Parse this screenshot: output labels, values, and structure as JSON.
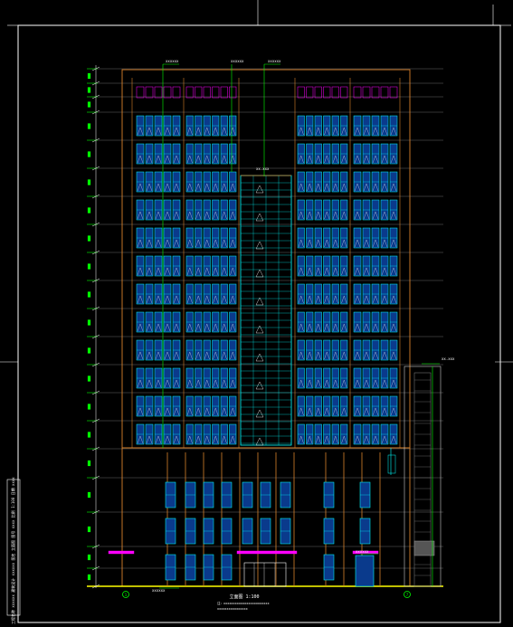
{
  "drawing": {
    "title": "立面图 1:100",
    "notes": [
      "注：xxxxxxxxxxxxxxxxxxxxxxxx",
      "xxxxxxxxxxxxxxxx"
    ],
    "title_block_text": "工程名称 xxxxxx 建筑设计 xxxxxx 图名 立面图 图号 xxxx 比例 1:100 日期 xxxx",
    "callout_top_left": "xxxxxx",
    "callout_top_center": "xxxxxx",
    "callout_top_right": "xxxxxx",
    "callout_mid": "xx.xxx",
    "callout_right": "xx.xxx",
    "callout_bottom_left": "xxxxxx",
    "callout_bottom_right": "xxxxxx",
    "axis_left": "1",
    "axis_right": "7",
    "colors": {
      "frame": "#ffffff",
      "building_outline": "#d9822b",
      "window": "#00ffff",
      "window_fill": "#0a3a8c",
      "dimension": "#ffffff",
      "leader": "#00ff00",
      "canopy": "#ff00ff",
      "ground": "#ffff00",
      "level_tick": "#00ff00"
    }
  }
}
